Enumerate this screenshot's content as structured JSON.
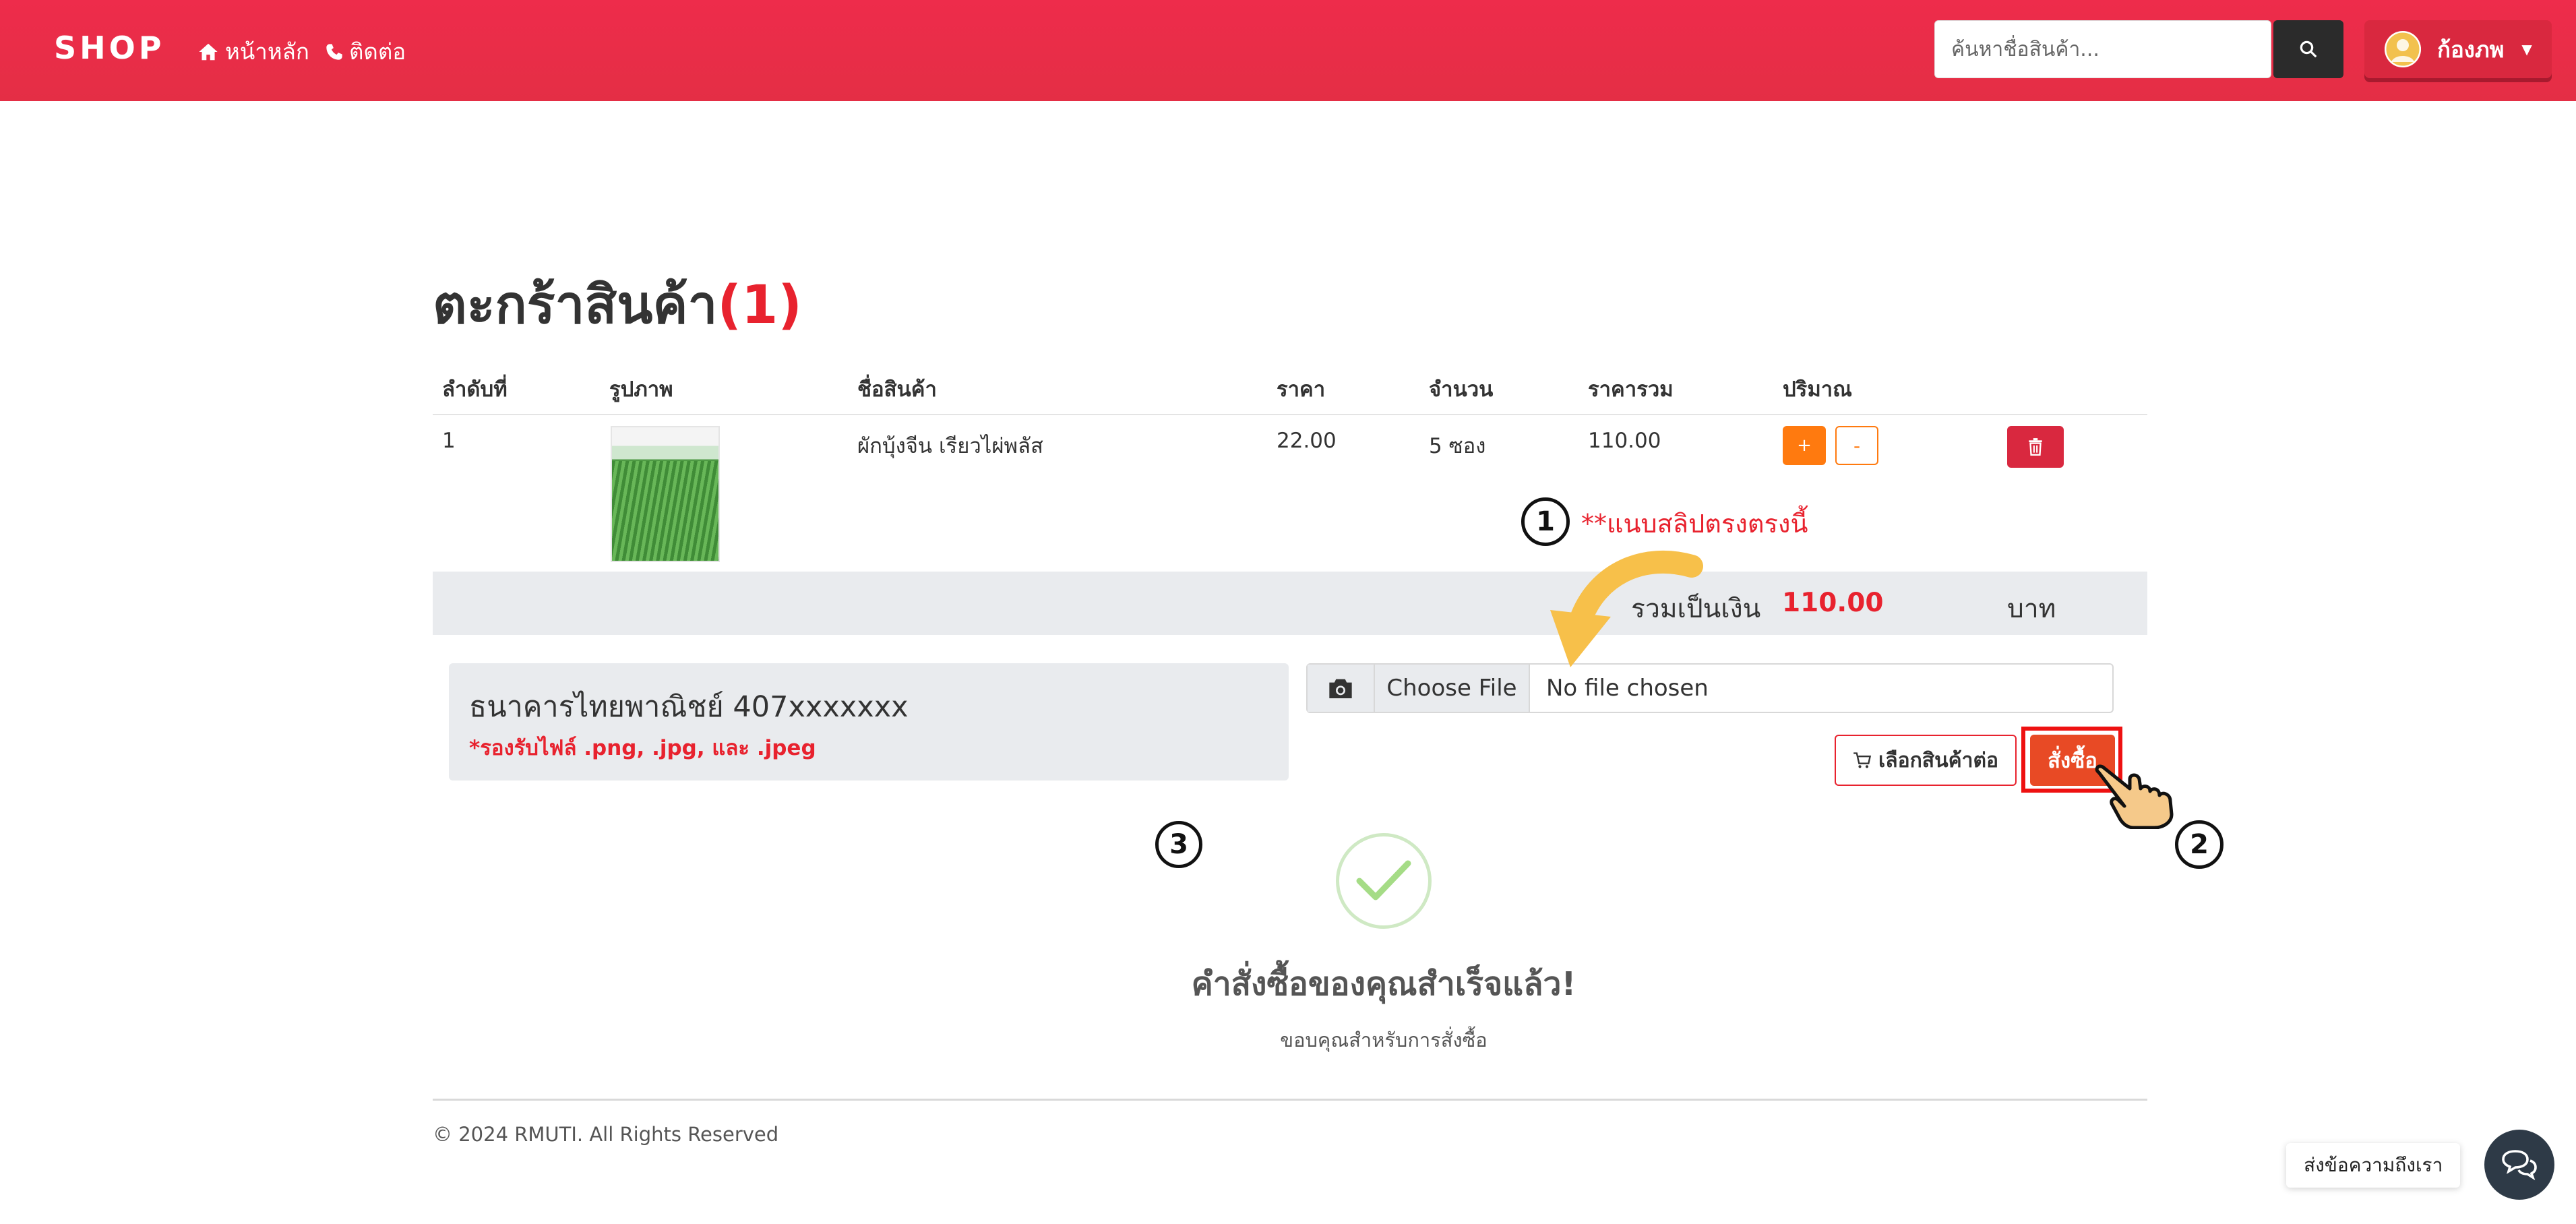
{
  "navbar": {
    "brand": "SHOP",
    "home_label": "หน้าหลัก",
    "contact_label": "ติดต่อ",
    "search_placeholder": "ค้นหาชื่อสินค้า...",
    "user_name": "ก้องภพ"
  },
  "cart": {
    "title": "ตะกร้าสินค้า",
    "count": "(1)",
    "headers": [
      "ลำดับที่",
      "รูปภาพ",
      "ชื่อสินค้า",
      "ราคา",
      "จำนวน",
      "ราคารวม",
      "ปริมาณ"
    ],
    "rows": [
      {
        "no": "1",
        "name": "ผักบุ้งจีน เรียวไผ่พลัส",
        "price": "22.00",
        "qty": "5 ซอง",
        "total": "110.00",
        "plus": "+",
        "minus": "-"
      }
    ],
    "total_label": "รวมเป็นเงิน",
    "total_value": "110.00",
    "total_unit": "บาท"
  },
  "payment": {
    "bank": "ธนาคารไทยพาณิชย์ 407xxxxxxx",
    "note": "*รองรับไฟล์ .png, .jpg, และ .jpeg",
    "choose_file": "Choose File",
    "no_file": "No file chosen",
    "continue_label": "เลือกสินค้าต่อ",
    "order_label": "สั่งซื้อ"
  },
  "annotations": {
    "step1": "1",
    "step1_text": "**แนบสลิปตรงตรงนี้",
    "step2": "2",
    "step3": "3"
  },
  "success": {
    "title": "คำสั่งซื้อของคุณสำเร็จแล้ว!",
    "subtitle": "ขอบคุณสำหรับการสั่งซื้อ"
  },
  "footer": {
    "text": "© 2024 RMUTI. All Rights Reserved"
  },
  "chat": {
    "label": "ส่งข้อความถึงเรา"
  },
  "colors": {
    "navbar": "#ee2c4b",
    "accent_red": "#e8222e",
    "orange": "#ff7a0f",
    "order_button": "#e84a25"
  }
}
